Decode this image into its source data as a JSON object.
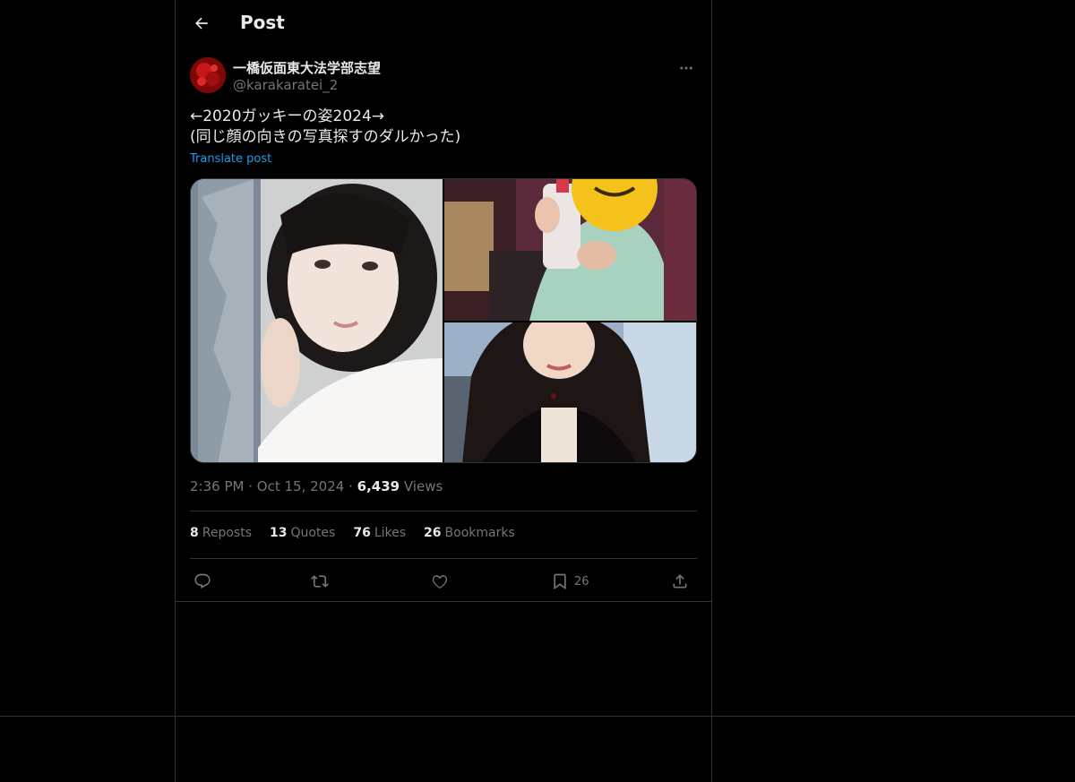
{
  "header": {
    "back_icon": "arrow-left-icon",
    "title": "Post"
  },
  "author": {
    "display_name": "一橋仮面東大法学部志望",
    "handle": "@karakaratei_2",
    "avatar_color": "#b31212"
  },
  "post": {
    "text_lines": [
      "←2020ガッキーの姿2024→",
      "(同じ顔の向きの写真探すのダルかった)"
    ],
    "translate_label": "Translate post",
    "media": [
      {
        "name": "photo-1"
      },
      {
        "name": "photo-2"
      },
      {
        "name": "photo-3"
      }
    ]
  },
  "meta": {
    "time": "2:36 PM",
    "separator": "·",
    "date": "Oct 15, 2024",
    "views_count": "6,439",
    "views_label": "Views"
  },
  "stats": [
    {
      "count": "8",
      "label": "Reposts"
    },
    {
      "count": "13",
      "label": "Quotes"
    },
    {
      "count": "76",
      "label": "Likes"
    },
    {
      "count": "26",
      "label": "Bookmarks"
    }
  ],
  "actions": {
    "reply": {
      "icon": "reply-icon",
      "count": ""
    },
    "repost": {
      "icon": "repost-icon",
      "count": ""
    },
    "like": {
      "icon": "heart-icon",
      "count": ""
    },
    "bookmark": {
      "icon": "bookmark-icon",
      "count": "26"
    },
    "share": {
      "icon": "share-icon",
      "count": ""
    }
  },
  "colors": {
    "background": "#000000",
    "text": "#e7e9ea",
    "secondary": "#71767b",
    "accent": "#1d9bf0",
    "border": "#2f3336"
  }
}
